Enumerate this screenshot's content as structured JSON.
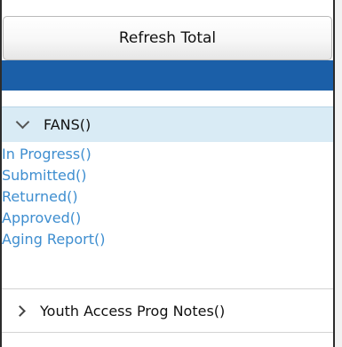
{
  "toolbar": {
    "refresh_label": "Refresh Total"
  },
  "sections": [
    {
      "title": "FANS()",
      "expanded": true,
      "chevron_icon": "chevron-down-icon",
      "links": [
        "In Progress()",
        "Submitted()",
        "Returned()",
        "Approved()",
        "Aging Report()"
      ]
    },
    {
      "title": "Youth Access Prog Notes()",
      "expanded": false,
      "chevron_icon": "chevron-right-icon"
    }
  ],
  "colors": {
    "header_bar": "#1b5fa8",
    "section_header_bg": "#d9ebf5",
    "link": "#3e8ed0"
  }
}
